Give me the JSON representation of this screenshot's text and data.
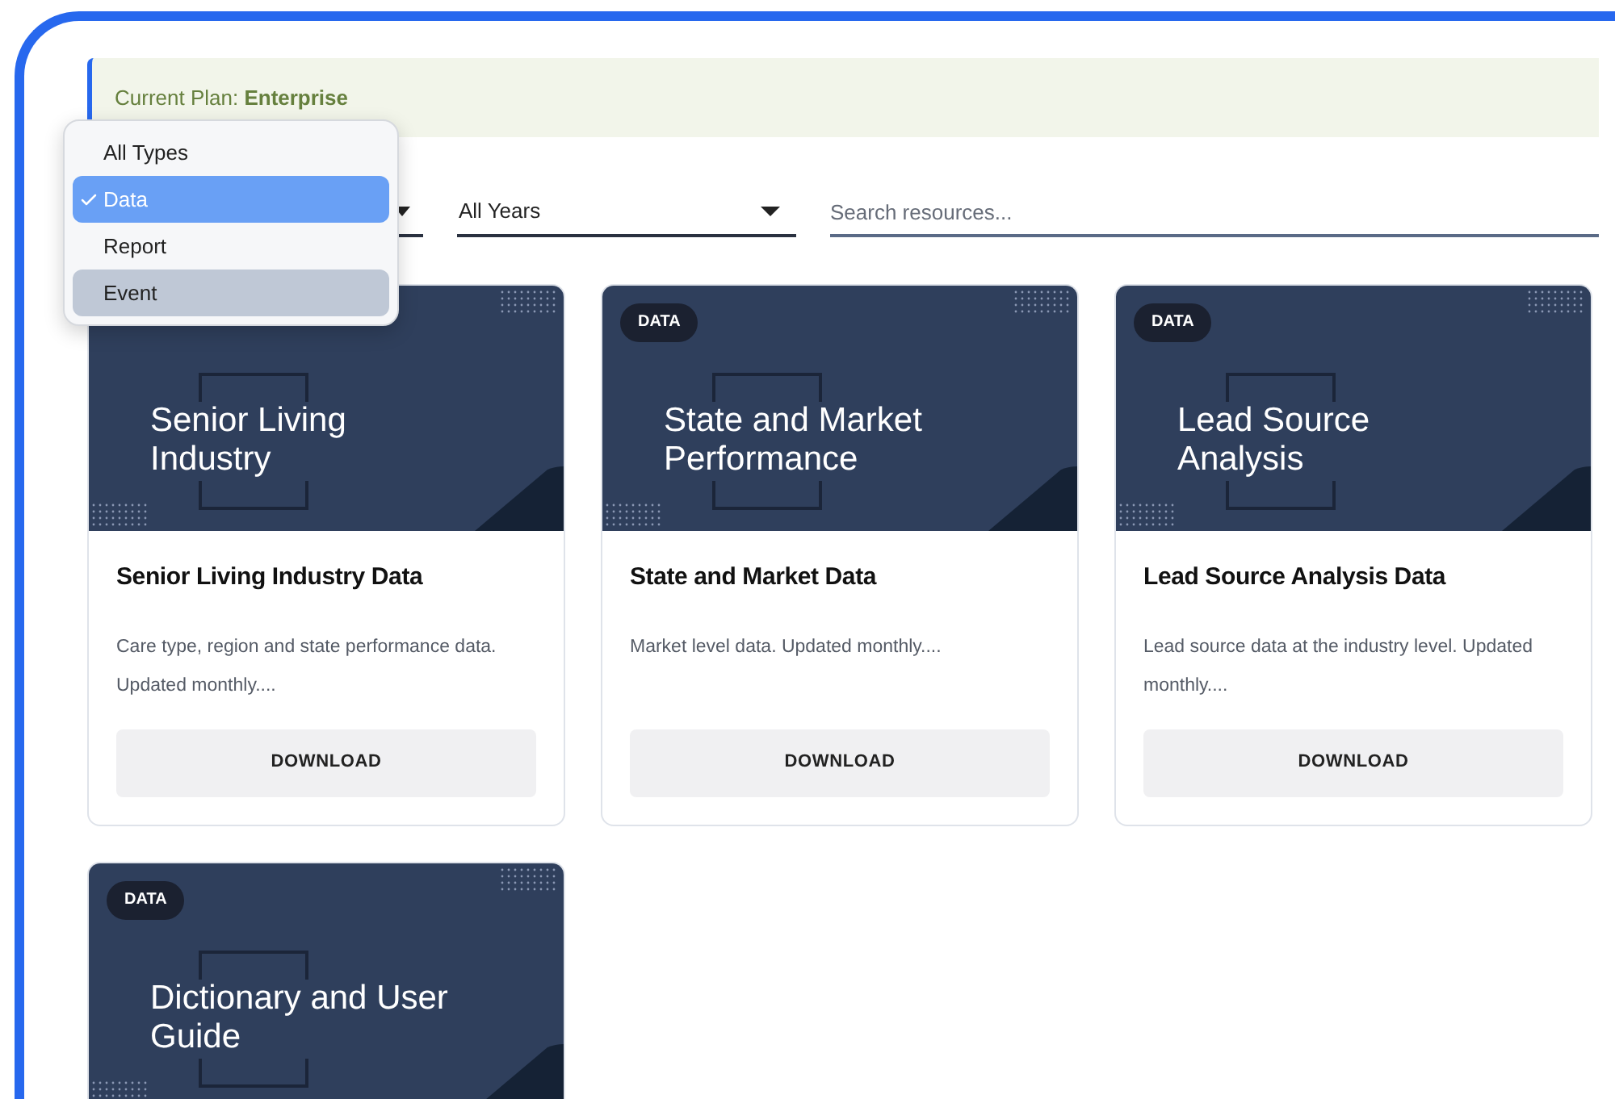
{
  "plan_banner": {
    "label": "Current Plan:",
    "plan": "Enterprise"
  },
  "filters": {
    "type_filter": {
      "options": [
        {
          "label": "All Types",
          "selected": false,
          "hovered": false
        },
        {
          "label": "Data",
          "selected": true,
          "hovered": false
        },
        {
          "label": "Report",
          "selected": false,
          "hovered": false
        },
        {
          "label": "Event",
          "selected": false,
          "hovered": true
        }
      ]
    },
    "year_filter": {
      "value": "All Years"
    },
    "search": {
      "placeholder": "Search resources..."
    }
  },
  "cards": [
    {
      "cover_title": "Senior Living Industry",
      "title": "Senior Living Industry Data",
      "description": "Care type, region and state performance data. Updated monthly....",
      "button": "DOWNLOAD"
    },
    {
      "badge": "DATA",
      "cover_title": "State and Market Performance",
      "title": "State and Market Data",
      "description": "Market level data. Updated monthly....",
      "button": "DOWNLOAD"
    },
    {
      "badge": "DATA",
      "cover_title": "Lead Source Analysis",
      "title": "Lead Source Analysis Data",
      "description": "Lead source data at the industry level. Updated monthly....",
      "button": "DOWNLOAD"
    },
    {
      "badge": "DATA",
      "cover_title": "Dictionary and User Guide"
    }
  ]
}
